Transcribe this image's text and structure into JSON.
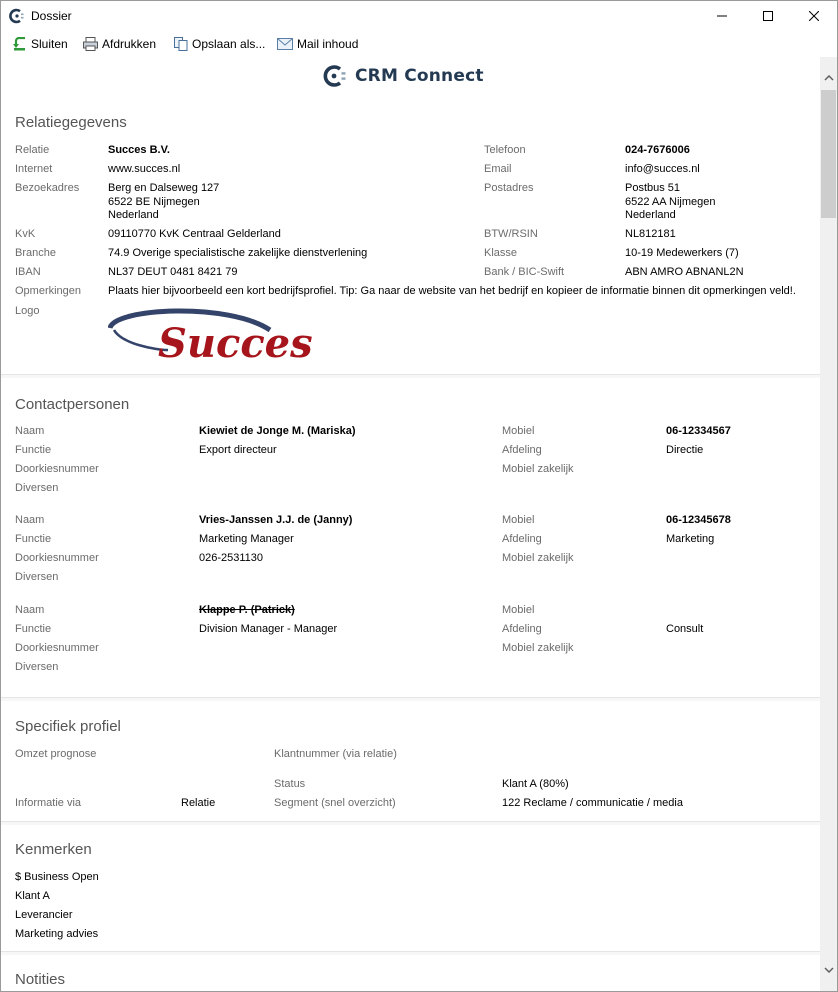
{
  "window": {
    "title": "Dossier",
    "minimize": "—",
    "maximize": "☐",
    "close": "✕"
  },
  "toolbar": {
    "close_label": "Sluiten",
    "print_label": "Afdrukken",
    "save_label": "Opslaan als...",
    "mail_label": "Mail inhoud"
  },
  "brand": {
    "name": "CRM Connect",
    "color": "#233a52"
  },
  "relation": {
    "section_title": "Relatiegegevens",
    "labels": {
      "relatie": "Relatie",
      "internet": "Internet",
      "bezoekadres": "Bezoekadres",
      "kvk": "KvK",
      "branche": "Branche",
      "iban": "IBAN",
      "opmerkingen": "Opmerkingen",
      "logo": "Logo",
      "telefoon": "Telefoon",
      "email": "Email",
      "postadres": "Postadres",
      "btw": "BTW/RSIN",
      "klasse": "Klasse",
      "bank": "Bank / BIC-Swift"
    },
    "relatie": "Succes B.V.",
    "internet": "www.succes.nl",
    "bezoekadres": [
      "Berg en Dalseweg 127",
      "6522 BE Nijmegen",
      "Nederland"
    ],
    "kvk": "09110770 KvK Centraal Gelderland",
    "branche": "74.9 Overige specialistische zakelijke dienstverlening",
    "iban": "NL37 DEUT 0481 8421 79",
    "opmerkingen": "Plaats hier bijvoorbeeld een kort bedrijfsprofiel. Tip: Ga naar de website van het bedrijf en kopieer de informatie binnen dit opmerkingen veld!.",
    "telefoon": "024-7676006",
    "email": "info@succes.nl",
    "postadres": [
      "Postbus 51",
      "6522 AA Nijmegen",
      "Nederland"
    ],
    "btw": "NL812181",
    "klasse": "10-19 Medewerkers (7)",
    "bank": "ABN AMRO ABNANL2N",
    "logo_text": "Succes"
  },
  "contacts": {
    "section_title": "Contactpersonen",
    "labels": {
      "naam": "Naam",
      "functie": "Functie",
      "doorkiesnummer": "Doorkiesnummer",
      "diversen": "Diversen",
      "mobiel": "Mobiel",
      "afdeling": "Afdeling",
      "mobiel_zakelijk": "Mobiel zakelijk"
    },
    "people": [
      {
        "naam": "Kiewiet de Jonge M. (Mariska)",
        "functie": "Export directeur",
        "doorkiesnummer": "",
        "mobiel": "06-12334567",
        "afdeling": "Directie"
      },
      {
        "naam": "Vries-Janssen J.J. de (Janny)",
        "functie": "Marketing Manager",
        "doorkiesnummer": "026-2531130",
        "mobiel": "06-12345678",
        "afdeling": "Marketing"
      },
      {
        "naam": "Klappe P. (Patrick)",
        "functie": "Division Manager - Manager",
        "doorkiesnummer": "",
        "mobiel": "",
        "afdeling": "Consult"
      }
    ]
  },
  "profile": {
    "section_title": "Specifiek profiel",
    "omzet_label": "Omzet prognose",
    "klantnummer_label": "Klantnummer (via relatie)",
    "status_label": "Status",
    "status": "Klant A (80%)",
    "informatie_label": "Informatie via",
    "informatie": "Relatie",
    "segment_label": "Segment (snel overzicht)",
    "segment": "122 Reclame / communicatie / media"
  },
  "kenmerken": {
    "section_title": "Kenmerken",
    "items": [
      "$ Business Open",
      "Klant A",
      "Leverancier",
      "Marketing advies"
    ]
  },
  "notities": {
    "section_title": "Notities"
  }
}
